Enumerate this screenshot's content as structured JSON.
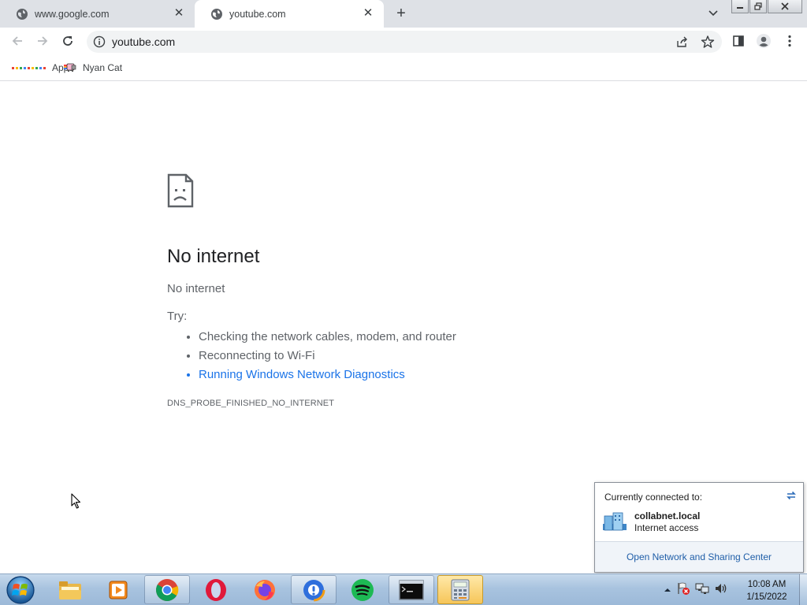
{
  "browser": {
    "tabs": [
      {
        "title": "www.google.com",
        "active": false
      },
      {
        "title": "youtube.com",
        "active": true
      }
    ],
    "address": "youtube.com",
    "bookmarks": [
      {
        "label": "Apps",
        "icon": "apps-grid-icon"
      },
      {
        "label": "Nyan Cat",
        "icon": "nyan-cat-icon"
      }
    ],
    "window_controls": [
      "minimize",
      "restore",
      "close"
    ]
  },
  "error_page": {
    "title": "No internet",
    "subtitle": "No internet",
    "try_label": "Try:",
    "suggestions": [
      {
        "text": "Checking the network cables, modem, and router",
        "link": false
      },
      {
        "text": "Reconnecting to Wi-Fi",
        "link": false
      },
      {
        "text": "Running Windows Network Diagnostics",
        "link": true
      }
    ],
    "error_code": "DNS_PROBE_FINISHED_NO_INTERNET"
  },
  "network_flyout": {
    "header": "Currently connected to:",
    "network_name": "collabnet.local",
    "network_status": "Internet access",
    "footer_link": "Open Network and Sharing Center"
  },
  "taskbar": {
    "apps": [
      {
        "name": "windows-explorer",
        "state": "normal"
      },
      {
        "name": "media-player",
        "state": "normal"
      },
      {
        "name": "chrome",
        "state": "open"
      },
      {
        "name": "opera",
        "state": "normal"
      },
      {
        "name": "firefox",
        "state": "normal"
      },
      {
        "name": "avast-browser",
        "state": "open"
      },
      {
        "name": "spotify",
        "state": "normal"
      },
      {
        "name": "command-prompt",
        "state": "open"
      },
      {
        "name": "calculator",
        "state": "active"
      }
    ],
    "clock_time": "10:08 AM",
    "clock_date": "1/15/2022"
  },
  "colors": {
    "tabstrip": "#dee1e6",
    "link": "#1a73e8",
    "text_secondary": "#5f6368",
    "taskbar": "#a8c3df"
  }
}
